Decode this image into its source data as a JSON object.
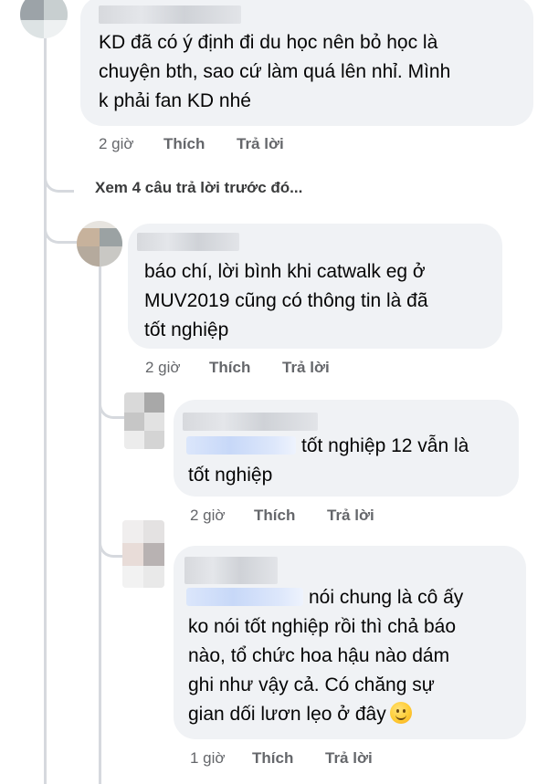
{
  "comments": [
    {
      "text_lines": [
        "KD đã có ý định đi du học nên bỏ học là",
        "chuyện bth, sao cứ làm quá lên nhỉ. Mình",
        "k phải fan KD nhé"
      ],
      "time": "2 giờ",
      "like_label": "Thích",
      "reply_label": "Trả lời"
    },
    {
      "text_lines": [
        "báo chí, lời bình khi catwalk eg ở",
        "MUV2019 cũng có thông tin là đã",
        "tốt nghiệp"
      ],
      "time": "2 giờ",
      "like_label": "Thích",
      "reply_label": "Trả lời"
    },
    {
      "text_lines": [
        "tốt nghiệp 12 vẫn là",
        "tốt nghiệp"
      ],
      "time": "2 giờ",
      "like_label": "Thích",
      "reply_label": "Trả lời"
    },
    {
      "text_lines": [
        "nói chung là cô ấy",
        "ko nói tốt nghiệp rồi thì chả báo",
        "nào, tổ chức hoa hậu nào dám",
        "ghi như vậy cả. Có chăng sự",
        "gian dối lươn lẹo ở đây"
      ],
      "emoji": "slightly-smiling-face-icon",
      "time": "1 giờ",
      "like_label": "Thích",
      "reply_label": "Trả lời"
    }
  ],
  "view_previous_replies": "Xem 4 câu trả lời trước đó..."
}
